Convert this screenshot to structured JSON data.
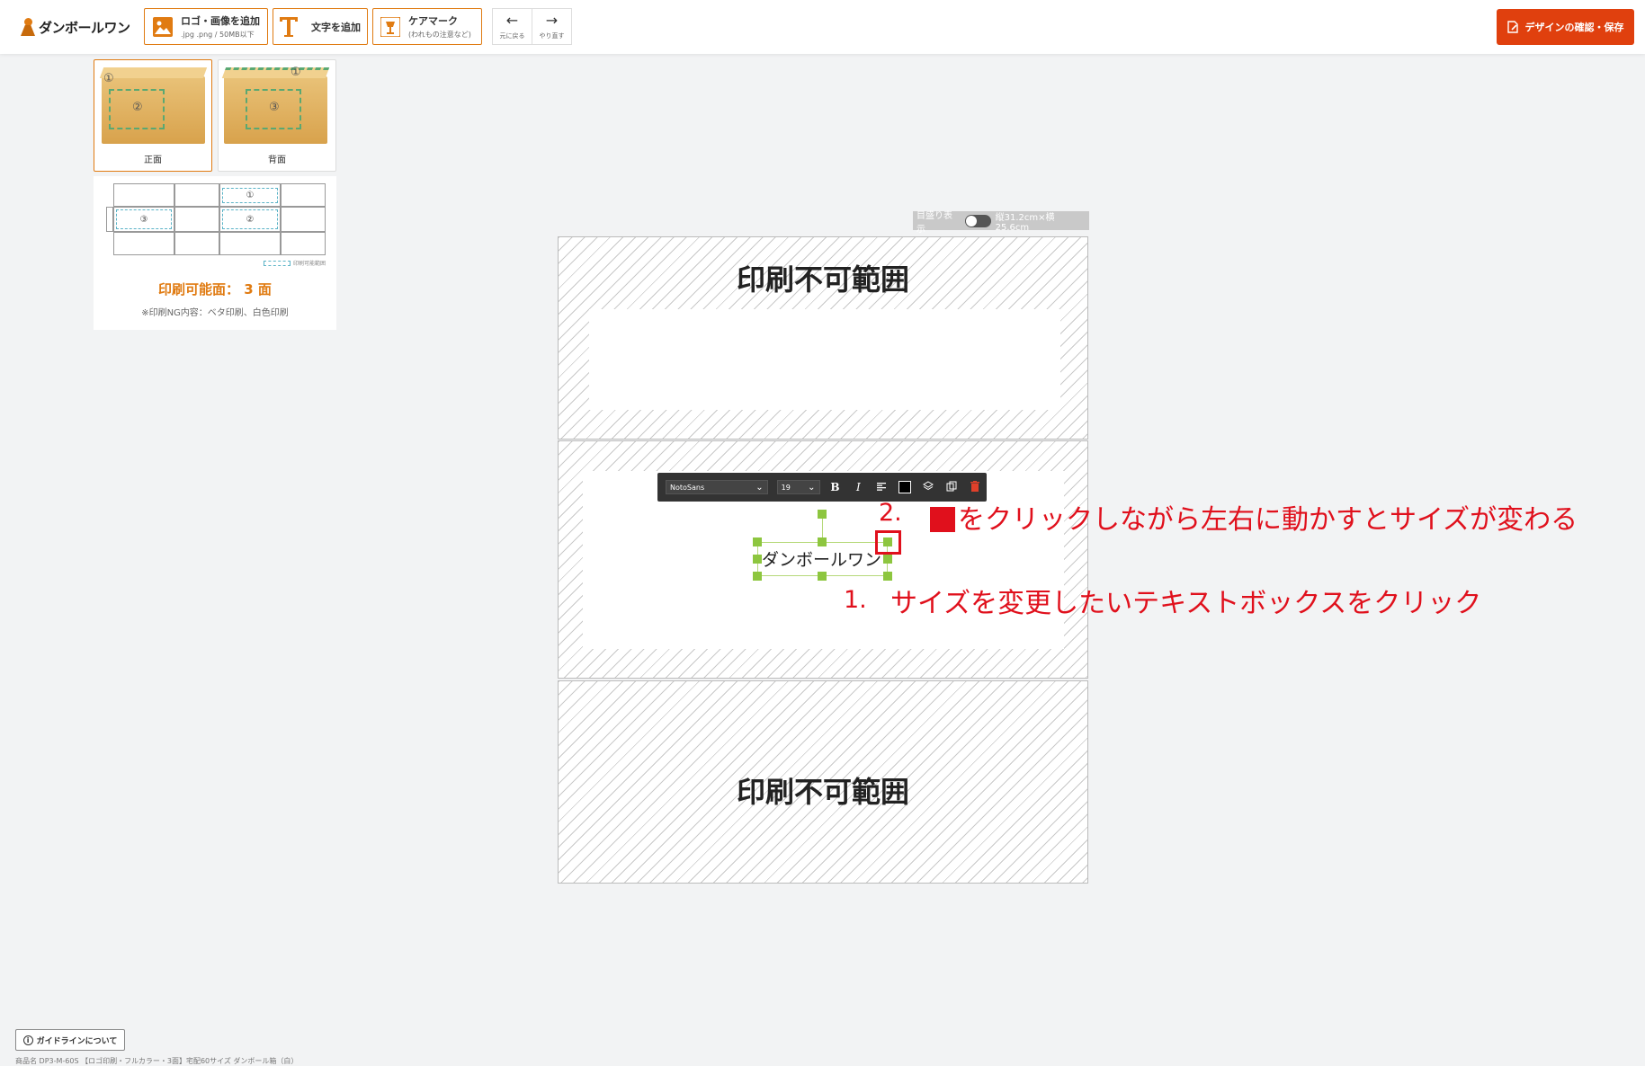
{
  "header": {
    "logo_text": "ダンボールワン",
    "add_image": {
      "label": "ロゴ・画像を追加",
      "sub": ".jpg .png / 50MB以下"
    },
    "add_text": {
      "label": "文字を追加"
    },
    "care_mark": {
      "label": "ケアマーク",
      "sub": "(われもの注意など)"
    },
    "undo_label": "元に戻る",
    "redo_label": "やり直す",
    "save_label": "デザインの確認・保存",
    "accent_color": "#e0400e"
  },
  "views": [
    {
      "label": "正面",
      "circles": [
        "①",
        "②"
      ],
      "active": true
    },
    {
      "label": "背面",
      "circles": [
        "①",
        "③"
      ],
      "active": false
    }
  ],
  "net": {
    "cells": [
      "①",
      "②",
      "③"
    ],
    "legend": "印刷可能範囲",
    "print_faces": "印刷可能面： 3 面",
    "note": "※印刷NG内容：ベタ印刷、白色印刷"
  },
  "canvas": {
    "trim_label": "目盛り表示",
    "dimensions": "縦31.2cm×横25.6cm",
    "unprintable_label": "印刷不可範囲"
  },
  "format_bar": {
    "font": "NotoSans",
    "size": "19",
    "bold": "B",
    "italic": "I",
    "align_icon": "align-left-icon",
    "color": "#000000"
  },
  "text_object": {
    "text": "ダンボールワン"
  },
  "annotations": {
    "step2_num": "2.",
    "step2_text": "をクリックしながら左右に動かすとサイズが変わる",
    "step1_num": "1.",
    "step1_text": "サイズを変更したいテキストボックスをクリック",
    "color": "#e0101c"
  },
  "footer": {
    "guide_label": "ガイドラインについて",
    "product_note": "商品名 DP3-M-60S 【ロゴ印刷・フルカラー・3面】宅配60サイズ ダンボール箱（白）"
  }
}
